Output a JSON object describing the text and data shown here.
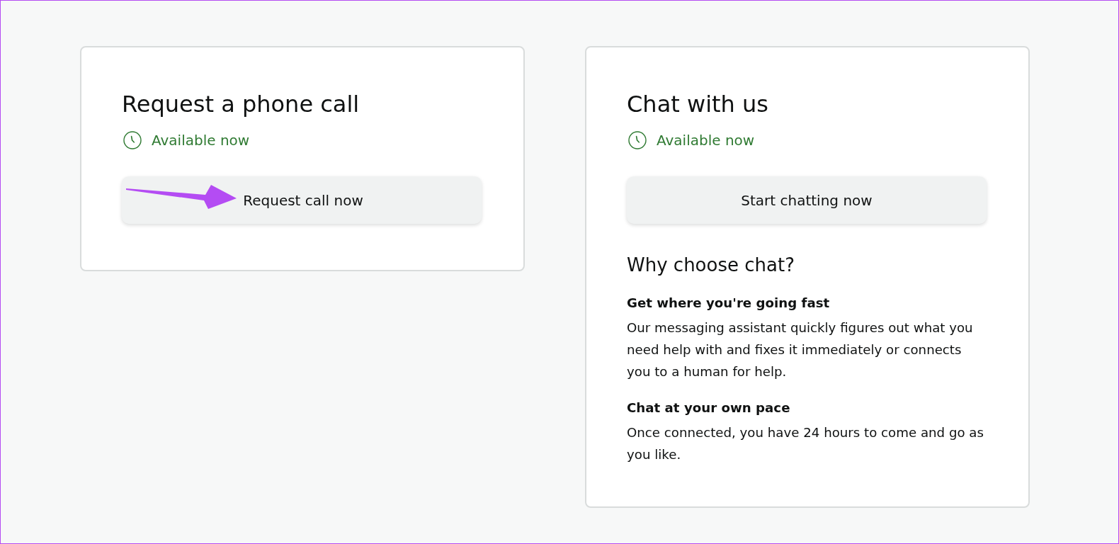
{
  "cards": [
    {
      "title": "Request a phone call",
      "status": "Available now",
      "button": {
        "label": "Request call now",
        "pointed_at": true
      }
    },
    {
      "title": "Chat with us",
      "status": "Available now",
      "button": {
        "label": "Start chatting now",
        "pointed_at": false
      },
      "section": {
        "title": "Why choose chat?",
        "items": [
          {
            "heading": "Get where you're going fast",
            "text": "Our messaging assistant quickly figures out what you need help with and fixes it immediately or connects you to a human for help."
          },
          {
            "heading": "Chat at your own pace",
            "text": "Once connected, you have 24 hours to come and go as you like."
          }
        ]
      }
    }
  ]
}
